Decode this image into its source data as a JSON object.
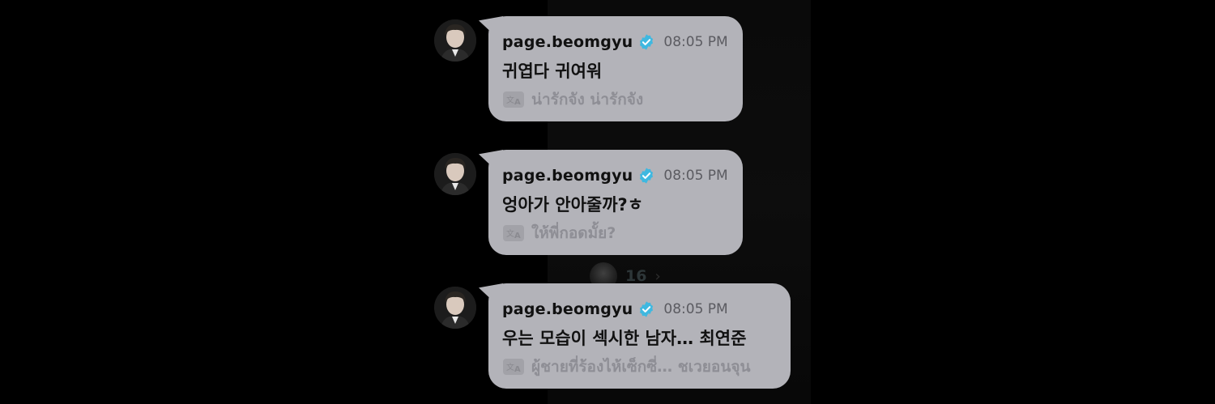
{
  "colors": {
    "background": "#000000",
    "bubble": "#b3b3b9",
    "username": "#111111",
    "timestamp": "#5b5b61",
    "translation": "#8e8e95",
    "verified": "#3fb8e0"
  },
  "icons": {
    "verified": "verified-badge-icon",
    "translate": "translate-icon",
    "chevron": "chevron-right-icon"
  },
  "background_reaction": {
    "count": "16",
    "chevron": "›"
  },
  "messages": [
    {
      "username": "page.beomgyu",
      "time": "08:05 PM",
      "text": "귀엽다 귀여워",
      "translation": "น่ารักจัง น่ารักจัง"
    },
    {
      "username": "page.beomgyu",
      "time": "08:05 PM",
      "text": "엉아가 안아줄까?ㅎ",
      "translation": "ให้พี่กอดมั้ย?"
    },
    {
      "username": "page.beomgyu",
      "time": "08:05 PM",
      "text": "우는 모습이 섹시한 남자… 최연준",
      "translation": "ผู้ชายที่ร้องไห้เซ็กซี่… ชเวยอนจุน"
    }
  ]
}
